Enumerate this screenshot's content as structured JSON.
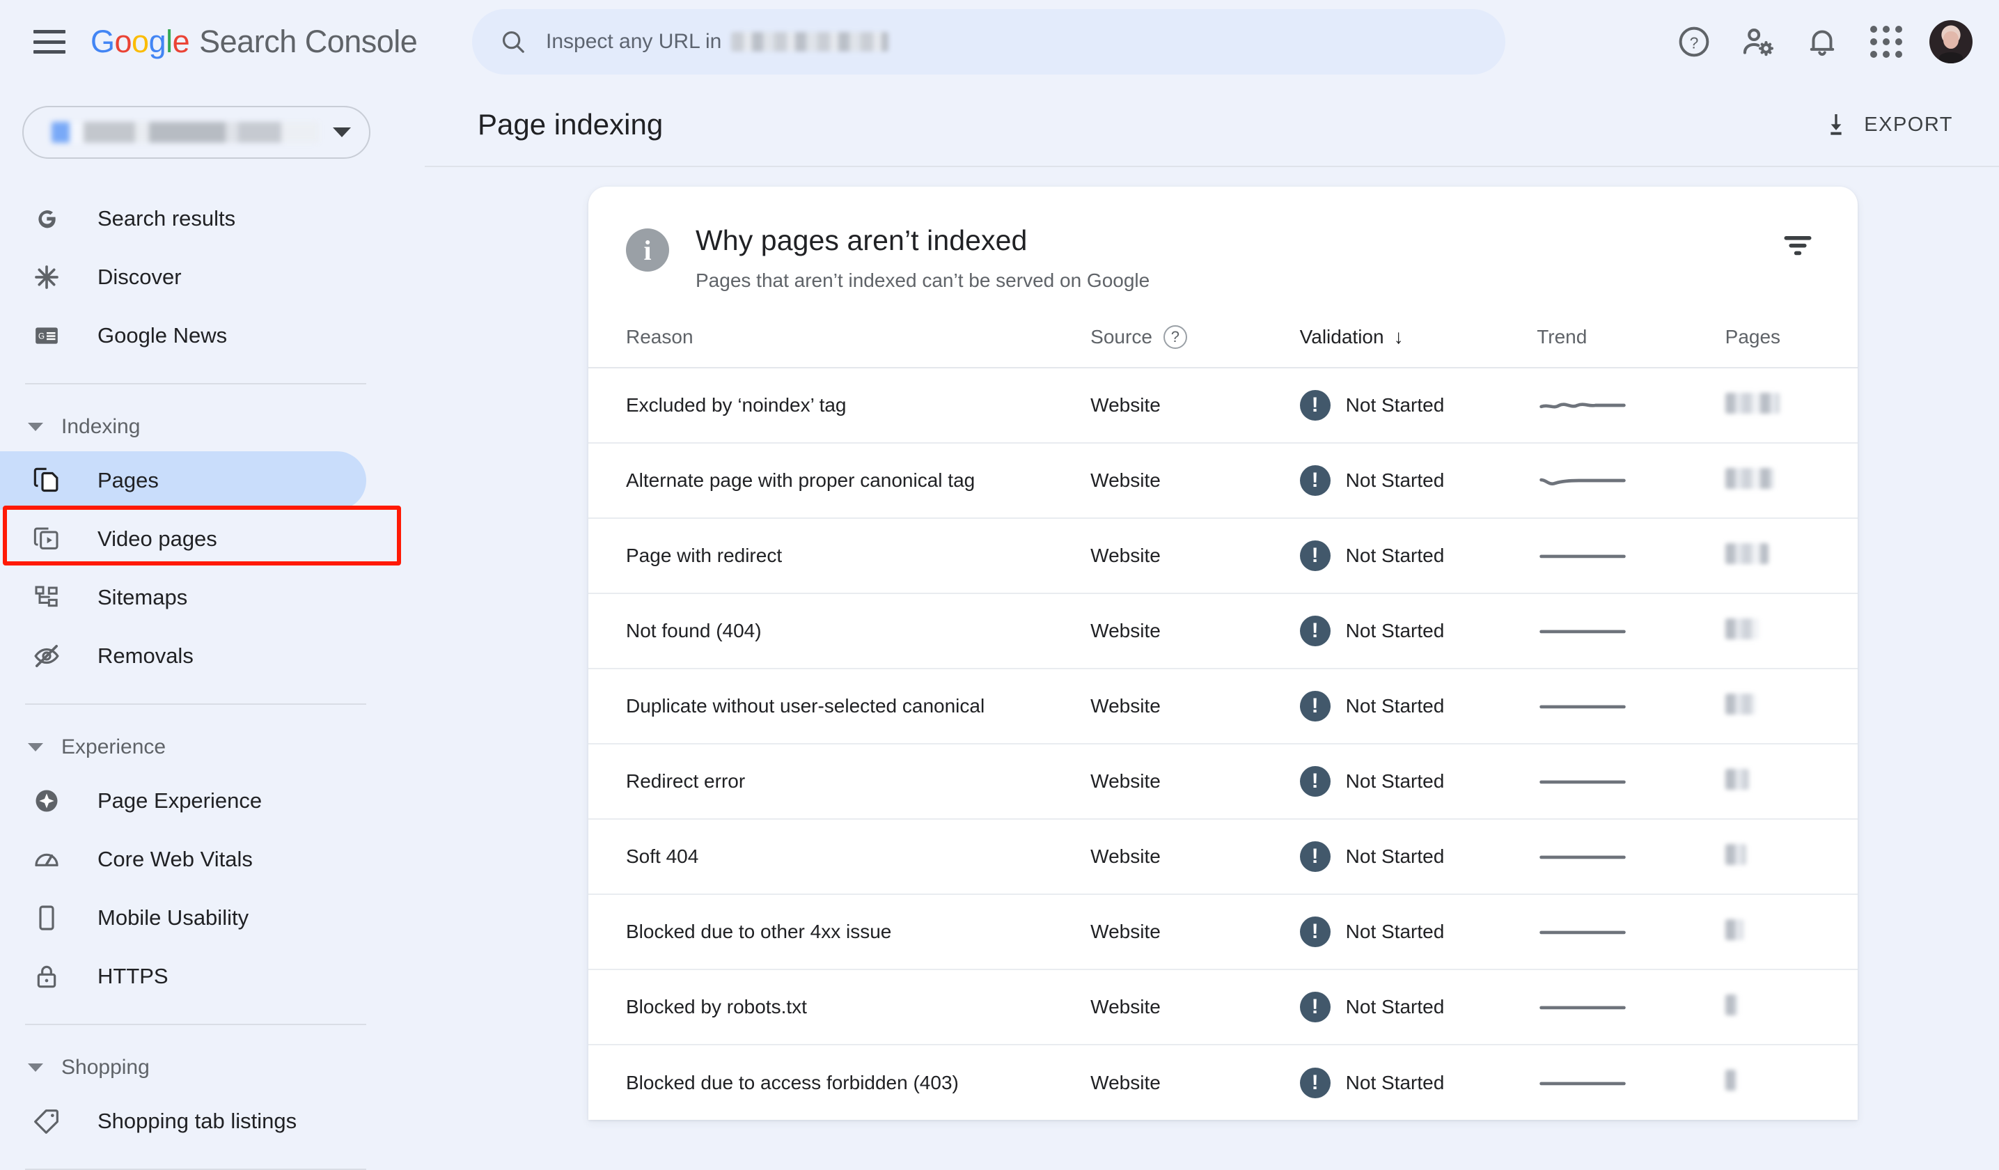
{
  "app": {
    "brand_google": [
      "G",
      "o",
      "o",
      "g",
      "l",
      "e"
    ],
    "brand_suffix": "Search Console"
  },
  "search": {
    "placeholder": "Inspect any URL in",
    "domain_redacted": true
  },
  "topbar_icons": [
    {
      "name": "help-icon",
      "label": "Help"
    },
    {
      "name": "user-settings-icon",
      "label": "User settings"
    },
    {
      "name": "notifications-bell-icon",
      "label": "Notifications"
    },
    {
      "name": "google-apps-icon",
      "label": "Google apps"
    },
    {
      "name": "avatar",
      "label": "Account"
    }
  ],
  "sidebar": {
    "property_selector": {
      "value_redacted": true,
      "caret": "chevron-down-icon"
    },
    "top_items": [
      {
        "label": "Search results",
        "icon": "google-g-icon"
      },
      {
        "label": "Discover",
        "icon": "asterisk-icon"
      },
      {
        "label": "Google News",
        "icon": "google-news-icon"
      }
    ],
    "sections": [
      {
        "title": "Indexing",
        "expanded": true,
        "items": [
          {
            "label": "Pages",
            "icon": "pages-copy-icon",
            "active": true,
            "highlighted": true
          },
          {
            "label": "Video pages",
            "icon": "video-pages-icon",
            "active": false
          },
          {
            "label": "Sitemaps",
            "icon": "sitemaps-icon",
            "active": false
          },
          {
            "label": "Removals",
            "icon": "eye-off-icon",
            "active": false
          }
        ]
      },
      {
        "title": "Experience",
        "expanded": true,
        "items": [
          {
            "label": "Page Experience",
            "icon": "page-experience-icon",
            "active": false
          },
          {
            "label": "Core Web Vitals",
            "icon": "speedometer-icon",
            "active": false
          },
          {
            "label": "Mobile Usability",
            "icon": "mobile-phone-icon",
            "active": false
          },
          {
            "label": "HTTPS",
            "icon": "lock-icon",
            "active": false
          }
        ]
      },
      {
        "title": "Shopping",
        "expanded": true,
        "items": [
          {
            "label": "Shopping tab listings",
            "icon": "price-tag-icon",
            "active": false
          }
        ]
      }
    ]
  },
  "page": {
    "title": "Page indexing",
    "export_label": "EXPORT",
    "export_icon": "download-icon"
  },
  "card": {
    "icon": "info-icon",
    "icon_glyph": "i",
    "title": "Why pages aren’t indexed",
    "subtitle": "Pages that aren’t indexed can’t be served on Google",
    "filter_icon": "filter-icon"
  },
  "table": {
    "columns": [
      {
        "key": "reason",
        "label": "Reason",
        "sorted": false
      },
      {
        "key": "source",
        "label": "Source",
        "sorted": false,
        "help_icon": "help-circle-icon",
        "help_glyph": "?"
      },
      {
        "key": "validation",
        "label": "Validation",
        "sorted": true,
        "sort_direction": "desc",
        "sort_glyph": "↓"
      },
      {
        "key": "trend",
        "label": "Trend",
        "sorted": false
      },
      {
        "key": "pages",
        "label": "Pages",
        "sorted": false
      }
    ],
    "rows": [
      {
        "reason": "Excluded by ‘noindex’ tag",
        "source": "Website",
        "validation": "Not Started",
        "status_icon": "error-exclamation-icon",
        "trend": "wavy-flat",
        "pages_redacted": true,
        "pages_blur_width": 78
      },
      {
        "reason": "Alternate page with proper canonical tag",
        "source": "Website",
        "validation": "Not Started",
        "status_icon": "error-exclamation-icon",
        "trend": "dip-flat",
        "pages_redacted": true,
        "pages_blur_width": 70
      },
      {
        "reason": "Page with redirect",
        "source": "Website",
        "validation": "Not Started",
        "status_icon": "error-exclamation-icon",
        "trend": "flat",
        "pages_redacted": true,
        "pages_blur_width": 62
      },
      {
        "reason": "Not found (404)",
        "source": "Website",
        "validation": "Not Started",
        "status_icon": "error-exclamation-icon",
        "trend": "flat",
        "pages_redacted": true,
        "pages_blur_width": 48
      },
      {
        "reason": "Duplicate without user-selected canonical",
        "source": "Website",
        "validation": "Not Started",
        "status_icon": "error-exclamation-icon",
        "trend": "flat",
        "pages_redacted": true,
        "pages_blur_width": 44
      },
      {
        "reason": "Redirect error",
        "source": "Website",
        "validation": "Not Started",
        "status_icon": "error-exclamation-icon",
        "trend": "flat",
        "pages_redacted": true,
        "pages_blur_width": 34
      },
      {
        "reason": "Soft 404",
        "source": "Website",
        "validation": "Not Started",
        "status_icon": "error-exclamation-icon",
        "trend": "flat",
        "pages_redacted": true,
        "pages_blur_width": 30
      },
      {
        "reason": "Blocked due to other 4xx issue",
        "source": "Website",
        "validation": "Not Started",
        "status_icon": "error-exclamation-icon",
        "trend": "flat",
        "pages_redacted": true,
        "pages_blur_width": 26
      },
      {
        "reason": "Blocked by robots.txt",
        "source": "Website",
        "validation": "Not Started",
        "status_icon": "error-exclamation-icon",
        "trend": "flat",
        "pages_redacted": true,
        "pages_blur_width": 18
      },
      {
        "reason": "Blocked due to access forbidden (403)",
        "source": "Website",
        "validation": "Not Started",
        "status_icon": "error-exclamation-icon",
        "trend": "flat",
        "pages_redacted": true,
        "pages_blur_width": 16
      }
    ]
  },
  "colors": {
    "page_bg": "#eef2fb",
    "card_bg": "#ffffff",
    "accent_blue": "#4285F4",
    "active_nav_bg": "#c9ddfb",
    "status_slate": "#42586b",
    "highlight_red": "#ff1a05"
  }
}
